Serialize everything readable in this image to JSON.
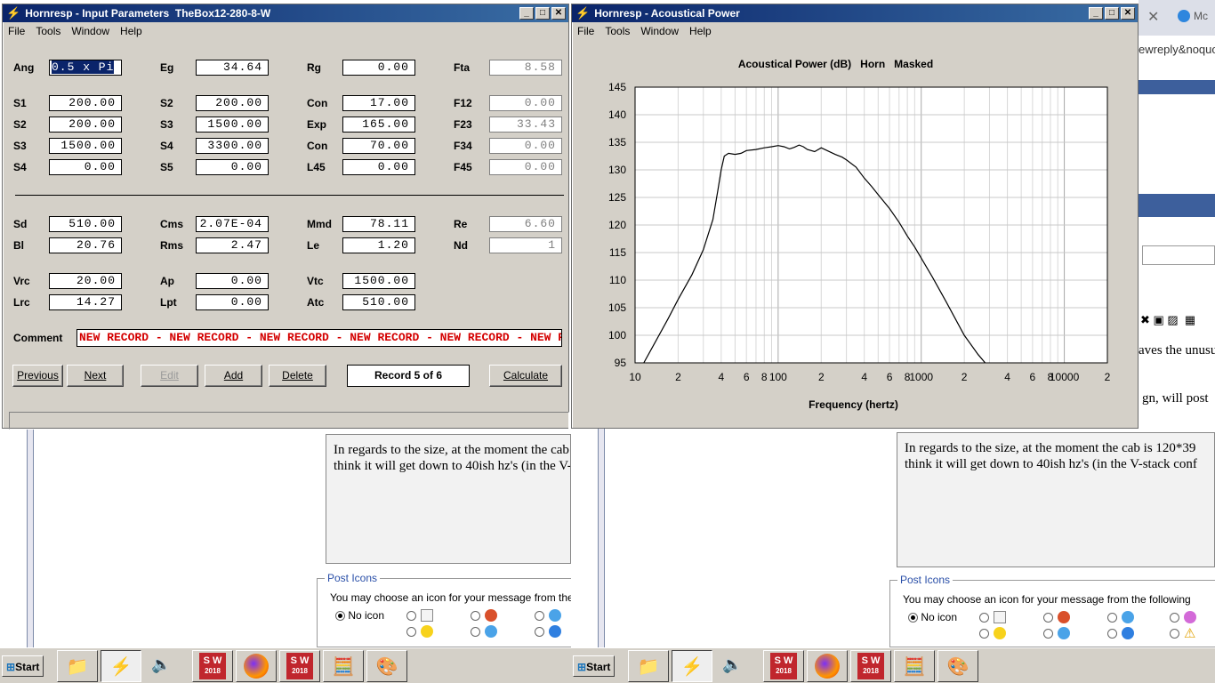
{
  "input_window": {
    "title": "Hornresp - Input Parameters  TheBox12-280-8-W",
    "menu": [
      "File",
      "Tools",
      "Window",
      "Help"
    ],
    "rows": [
      [
        [
          "Ang",
          "0.5 x Pi"
        ],
        [
          "Eg",
          "34.64"
        ],
        [
          "Rg",
          "0.00"
        ],
        [
          "Fta",
          "8.58"
        ]
      ],
      [
        [
          "S1",
          "200.00"
        ],
        [
          "S2",
          "200.00"
        ],
        [
          "Con",
          "17.00"
        ],
        [
          "F12",
          "0.00"
        ]
      ],
      [
        [
          "S2",
          "200.00"
        ],
        [
          "S3",
          "1500.00"
        ],
        [
          "Exp",
          "165.00"
        ],
        [
          "F23",
          "33.43"
        ]
      ],
      [
        [
          "S3",
          "1500.00"
        ],
        [
          "S4",
          "3300.00"
        ],
        [
          "Con",
          "70.00"
        ],
        [
          "F34",
          "0.00"
        ]
      ],
      [
        [
          "S4",
          "0.00"
        ],
        [
          "S5",
          "0.00"
        ],
        [
          "L45",
          "0.00"
        ],
        [
          "F45",
          "0.00"
        ]
      ],
      [
        [
          "Sd",
          "510.00"
        ],
        [
          "Cms",
          "2.07E-04"
        ],
        [
          "Mmd",
          "78.11"
        ],
        [
          "Re",
          "6.60"
        ]
      ],
      [
        [
          "Bl",
          "20.76"
        ],
        [
          "Rms",
          "2.47"
        ],
        [
          "Le",
          "1.20"
        ],
        [
          "Nd",
          "1"
        ]
      ],
      [
        [
          "Vrc",
          "20.00"
        ],
        [
          "Ap",
          "0.00"
        ],
        [
          "Vtc",
          "1500.00"
        ]
      ],
      [
        [
          "Lrc",
          "14.27"
        ],
        [
          "Lpt",
          "0.00"
        ],
        [
          "Atc",
          "510.00"
        ]
      ]
    ],
    "comment_label": "Comment",
    "comment_value": "NEW RECORD - NEW RECORD - NEW RECORD - NEW RECORD - NEW RECORD - NEW RE",
    "buttons": {
      "previous": "Previous",
      "next": "Next",
      "edit": "Edit",
      "add": "Add",
      "delete": "Delete",
      "calculate": "Calculate"
    },
    "record": "Record 5 of 6"
  },
  "chart_window": {
    "title": "Hornresp - Acoustical Power",
    "menu": [
      "File",
      "Tools",
      "Window",
      "Help"
    ]
  },
  "chart_data": {
    "type": "line",
    "title": "Acoustical Power (dB)   Horn   Masked",
    "xlabel": "Frequency (hertz)",
    "ylabel": "",
    "xscale": "log",
    "xlim": [
      10,
      20000
    ],
    "ylim": [
      95,
      145
    ],
    "yticks": [
      95,
      100,
      105,
      110,
      115,
      120,
      125,
      130,
      135,
      140,
      145
    ],
    "xtick_labels": [
      [
        "10",
        10
      ],
      [
        "2",
        20
      ],
      [
        "4",
        40
      ],
      [
        "6",
        60
      ],
      [
        "8",
        80
      ],
      [
        "100",
        100
      ],
      [
        "2",
        200
      ],
      [
        "4",
        400
      ],
      [
        "6",
        600
      ],
      [
        "8",
        800
      ],
      [
        "1000",
        1000
      ],
      [
        "2",
        2000
      ],
      [
        "4",
        4000
      ],
      [
        "6",
        6000
      ],
      [
        "8",
        8000
      ],
      [
        "10000",
        10000
      ],
      [
        "2",
        20000
      ]
    ],
    "grid": true,
    "x": [
      11.5,
      14,
      17,
      20,
      25,
      30,
      35,
      38,
      40,
      42,
      45,
      50,
      55,
      60,
      70,
      80,
      90,
      100,
      110,
      120,
      130,
      140,
      150,
      160,
      180,
      200,
      220,
      250,
      280,
      300,
      350,
      400,
      450,
      500,
      600,
      700,
      800,
      900,
      1000,
      1200,
      1500,
      2000,
      2500,
      2800
    ],
    "y": [
      95,
      99,
      103,
      106.5,
      111,
      115.5,
      121,
      126.5,
      130,
      132.5,
      133,
      132.8,
      133,
      133.5,
      133.7,
      134,
      134.2,
      134.4,
      134.2,
      133.8,
      134.1,
      134.5,
      134.2,
      133.7,
      133.3,
      134,
      133.5,
      132.8,
      132.3,
      131.8,
      130.5,
      128.5,
      127,
      125.5,
      123,
      120.5,
      118,
      116,
      114,
      110.5,
      106,
      100,
      96.5,
      95
    ]
  },
  "background": {
    "tab_url_fragment": "ewreply&noquo",
    "post_text_line1": "In regards to the size, at the moment the cab is 120*39",
    "post_text_line2": "think it will get down to 40ish hz's (in the V-stack conf",
    "side_text_1": "aves the unusu",
    "side_text_2": "gn, will post",
    "post_icons_legend": "Post Icons",
    "post_icons_text": "You may choose an icon for your message from the following",
    "no_icon": "No icon",
    "tab_label": "Mc"
  },
  "taskbar": {
    "start": "Start",
    "sw_label": "S W",
    "sw_year": "2018"
  }
}
